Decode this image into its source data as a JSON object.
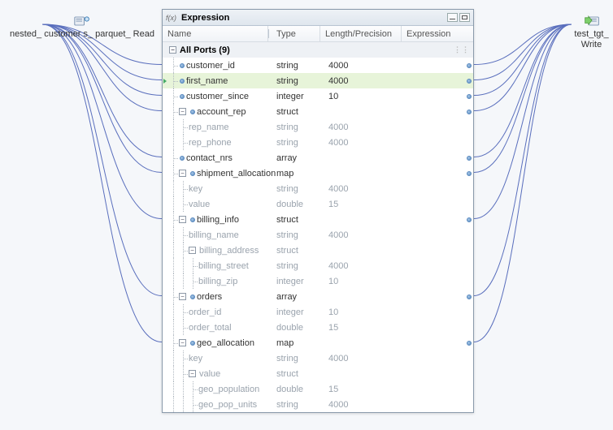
{
  "source_node": {
    "label": "nested_\ncustomer\ns_\nparquet_\nRead"
  },
  "target_node": {
    "label": "test_tgt_\nWrite"
  },
  "panel": {
    "title": "Expression",
    "columns": {
      "name": "Name",
      "type": "Type",
      "len": "Length/Precision",
      "expr": "Expression"
    },
    "all_ports_label": "All Ports (9)"
  },
  "rows": [
    {
      "name": "customer_id",
      "type": "string",
      "len": "4000",
      "depth": 1,
      "leaf": true,
      "dim": false,
      "port": true,
      "highlight": false
    },
    {
      "name": "first_name",
      "type": "string",
      "len": "4000",
      "depth": 1,
      "leaf": true,
      "dim": false,
      "port": true,
      "highlight": true
    },
    {
      "name": "customer_since",
      "type": "integer",
      "len": "10",
      "depth": 1,
      "leaf": true,
      "dim": false,
      "port": true,
      "highlight": false
    },
    {
      "name": "account_rep",
      "type": "struct",
      "len": "",
      "depth": 1,
      "leaf": false,
      "dim": false,
      "port": true,
      "highlight": false
    },
    {
      "name": "rep_name",
      "type": "string",
      "len": "4000",
      "depth": 2,
      "leaf": true,
      "dim": true,
      "port": false,
      "highlight": false
    },
    {
      "name": "rep_phone",
      "type": "string",
      "len": "4000",
      "depth": 2,
      "leaf": true,
      "dim": true,
      "port": false,
      "highlight": false
    },
    {
      "name": "contact_nrs",
      "type": "array",
      "len": "",
      "depth": 1,
      "leaf": true,
      "dim": false,
      "port": true,
      "highlight": false
    },
    {
      "name": "shipment_allocation",
      "type": "map",
      "len": "",
      "depth": 1,
      "leaf": false,
      "dim": false,
      "port": true,
      "highlight": false
    },
    {
      "name": "key",
      "type": "string",
      "len": "4000",
      "depth": 2,
      "leaf": true,
      "dim": true,
      "port": false,
      "highlight": false
    },
    {
      "name": "value",
      "type": "double",
      "len": "15",
      "depth": 2,
      "leaf": true,
      "dim": true,
      "port": false,
      "highlight": false
    },
    {
      "name": "billing_info",
      "type": "struct",
      "len": "",
      "depth": 1,
      "leaf": false,
      "dim": false,
      "port": true,
      "highlight": false
    },
    {
      "name": "billing_name",
      "type": "string",
      "len": "4000",
      "depth": 2,
      "leaf": true,
      "dim": true,
      "port": false,
      "highlight": false
    },
    {
      "name": "billing_address",
      "type": "struct",
      "len": "",
      "depth": 2,
      "leaf": false,
      "dim": true,
      "port": false,
      "highlight": false
    },
    {
      "name": "billing_street",
      "type": "string",
      "len": "4000",
      "depth": 3,
      "leaf": true,
      "dim": true,
      "port": false,
      "highlight": false
    },
    {
      "name": "billing_zip",
      "type": "integer",
      "len": "10",
      "depth": 3,
      "leaf": true,
      "dim": true,
      "port": false,
      "highlight": false
    },
    {
      "name": "orders",
      "type": "array",
      "len": "",
      "depth": 1,
      "leaf": false,
      "dim": false,
      "port": true,
      "highlight": false
    },
    {
      "name": "order_id",
      "type": "integer",
      "len": "10",
      "depth": 2,
      "leaf": true,
      "dim": true,
      "port": false,
      "highlight": false
    },
    {
      "name": "order_total",
      "type": "double",
      "len": "15",
      "depth": 2,
      "leaf": true,
      "dim": true,
      "port": false,
      "highlight": false
    },
    {
      "name": "geo_allocation",
      "type": "map",
      "len": "",
      "depth": 1,
      "leaf": false,
      "dim": false,
      "port": true,
      "highlight": false
    },
    {
      "name": "key",
      "type": "string",
      "len": "4000",
      "depth": 2,
      "leaf": true,
      "dim": true,
      "port": false,
      "highlight": false
    },
    {
      "name": "value",
      "type": "struct",
      "len": "",
      "depth": 2,
      "leaf": false,
      "dim": true,
      "port": false,
      "highlight": false
    },
    {
      "name": "geo_population",
      "type": "double",
      "len": "15",
      "depth": 3,
      "leaf": true,
      "dim": true,
      "port": false,
      "highlight": false
    },
    {
      "name": "geo_pop_units",
      "type": "string",
      "len": "4000",
      "depth": 3,
      "leaf": true,
      "dim": true,
      "port": false,
      "highlight": false
    }
  ],
  "port_row_indices": [
    0,
    1,
    2,
    3,
    6,
    7,
    10,
    15,
    18
  ]
}
